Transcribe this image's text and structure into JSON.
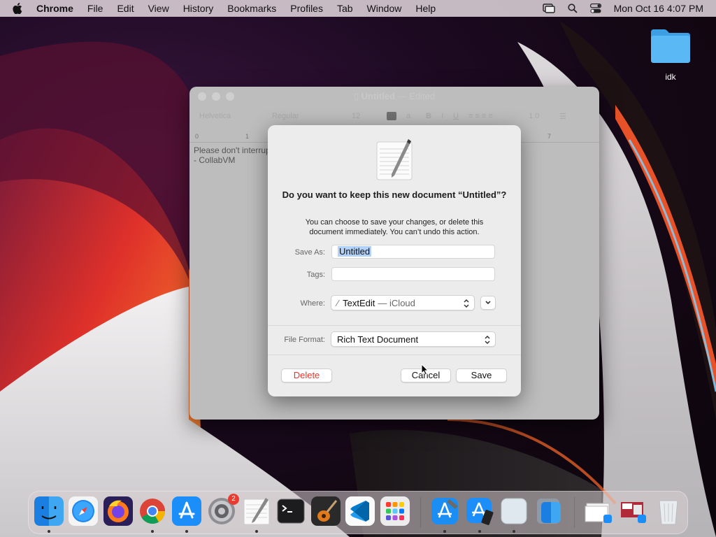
{
  "menubar": {
    "app": "Chrome",
    "items": [
      "File",
      "Edit",
      "View",
      "History",
      "Bookmarks",
      "Profiles",
      "Tab",
      "Window",
      "Help"
    ],
    "clock": "Mon Oct 16  4:07 PM"
  },
  "desktop": {
    "folder_label": "idk"
  },
  "textedit": {
    "title": "Untitled",
    "title_suffix": "— Edited",
    "toolbar": {
      "font": "Helvetica",
      "style": "Regular",
      "size": "12",
      "spacing": "1.0"
    },
    "ruler": [
      "0",
      "1",
      "7"
    ],
    "body_lines": [
      "Please don't interrup",
      "- CollabVM"
    ]
  },
  "dialog": {
    "title": "Do you want to keep this new document “Untitled”?",
    "message": "You can choose to save your changes, or delete this document immediately. You can’t undo this action.",
    "save_as_label": "Save As:",
    "save_as_value": "Untitled",
    "tags_label": "Tags:",
    "tags_value": "",
    "where_label": "Where:",
    "where_value": "TextEdit",
    "where_suffix": "— iCloud",
    "file_format_label": "File Format:",
    "file_format_value": "Rich Text Document",
    "delete_label": "Delete",
    "cancel_label": "Cancel",
    "save_label": "Save"
  },
  "dock": {
    "apps": [
      "finder-icon",
      "safari-icon",
      "firefox-icon",
      "chrome-icon",
      "app-store-icon",
      "system-preferences-icon",
      "textedit-icon",
      "terminal-icon",
      "garageband-icon",
      "vscode-icon",
      "launchpad-icon",
      "xcode-icon",
      "simulator-icon",
      "preview-icon",
      "finder-migration-icon",
      "downloads-stack-icon",
      "screenshots-stack-icon",
      "trash-icon"
    ],
    "badge_count": "2"
  },
  "colors": {
    "delete": "#e0382d",
    "selection": "#b3d2f9",
    "folder": "#4fb0f0"
  }
}
